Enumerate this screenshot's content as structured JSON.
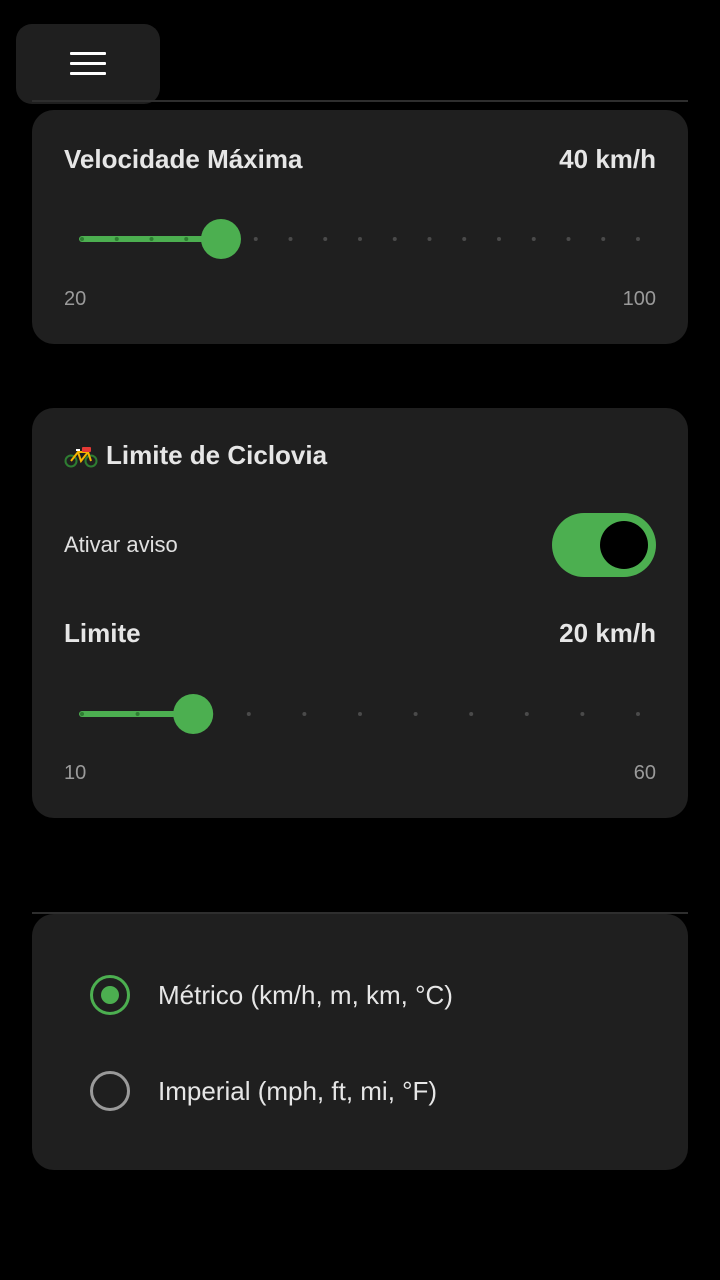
{
  "menu": {
    "icon": "hamburger-menu-icon"
  },
  "max_speed": {
    "title": "Velocidade Máxima",
    "value_text": "40 km/h",
    "min_label": "20",
    "max_label": "100",
    "slider": {
      "min": 20,
      "max": 100,
      "step": 5,
      "value": 40
    }
  },
  "bike_lane": {
    "icon": "bicycle-icon",
    "title": "Limite de Ciclovia",
    "toggle_label": "Ativar aviso",
    "toggle_on": true,
    "limit_title": "Limite",
    "limit_value_text": "20 km/h",
    "min_label": "10",
    "max_label": "60",
    "slider": {
      "min": 10,
      "max": 60,
      "step": 5,
      "value": 20
    }
  },
  "units": {
    "options": [
      {
        "label": "Métrico (km/h, m, km, °C)",
        "selected": true
      },
      {
        "label": "Imperial (mph, ft, mi, °F)",
        "selected": false
      }
    ]
  },
  "colors": {
    "accent": "#4caf50",
    "card": "#1f1f1f",
    "background": "#000000",
    "inactive_tick": "#4a4a4a"
  }
}
